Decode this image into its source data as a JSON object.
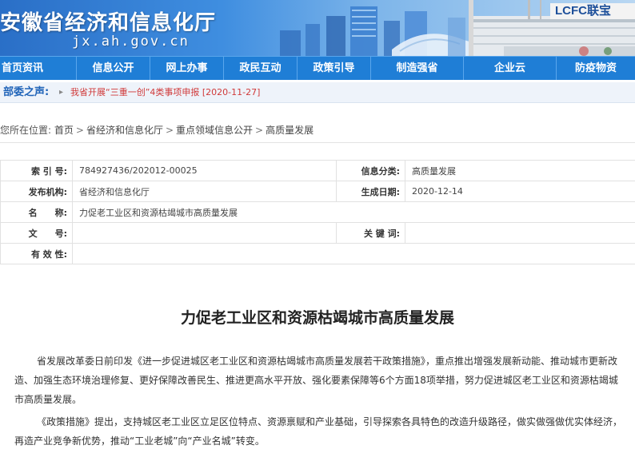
{
  "header": {
    "site_title": "安徽省经济和信息化厅",
    "site_domain": "jx.ah.gov.cn",
    "brand_sign": "LCFC联宝"
  },
  "nav": {
    "items": [
      {
        "label": "首页资讯"
      },
      {
        "label": "信息公开"
      },
      {
        "label": "网上办事"
      },
      {
        "label": "政民互动"
      },
      {
        "label": "政策引导"
      },
      {
        "label": "制造强省"
      },
      {
        "label": "企业云"
      },
      {
        "label": "防疫物资"
      }
    ]
  },
  "notice": {
    "label": "部委之声:",
    "text": "我省开展“三重一创”4类事项申报 [2020-11-27]"
  },
  "breadcrumb": {
    "prefix": "您所在位置:",
    "items": [
      "首页",
      "省经济和信息化厅",
      "重点领域信息公开",
      "高质量发展"
    ]
  },
  "info": {
    "index_label": "索 引 号:",
    "index_value": "784927436/202012-00025",
    "category_label": "信息分类:",
    "category_value": "高质量发展",
    "publisher_label": "发布机构:",
    "publisher_value": "省经济和信息化厅",
    "date_label": "生成日期:",
    "date_value": "2020-12-14",
    "name_label": "名　　称:",
    "name_value": "力促老工业区和资源枯竭城市高质量发展",
    "doc_no_label": "文　　号:",
    "doc_no_value": "",
    "keywords_label": "关 键 词:",
    "keywords_value": "",
    "validity_label": "有 效 性:",
    "validity_value": ""
  },
  "article": {
    "title": "力促老工业区和资源枯竭城市高质量发展",
    "p1": [
      "省发展改革委日前印发《进一步促进城区老工业区和资源枯竭城市高质量发展若干政策措施》，重点推出增强发展新动能、推动城市更新改",
      "造、加强生态环境治理修复、更好保障改善民生、推进更高水平开放、强化要素保障等6个方面18项举措，努力促进城区老工业区和资源枯竭城",
      "市高质量发展。"
    ],
    "p2": [
      "《政策措施》提出，支持城区老工业区立足区位特点、资源禀赋和产业基础，引导探索各具特色的改造升级路径，做实做强做优实体经济，",
      "再造产业竞争新优势，推动“工业老城”向“产业名城”转变。"
    ]
  },
  "colors": {
    "nav_bg": "#1f7ed6",
    "notice_text": "#d03a3a",
    "notice_label": "#1f63b8"
  }
}
